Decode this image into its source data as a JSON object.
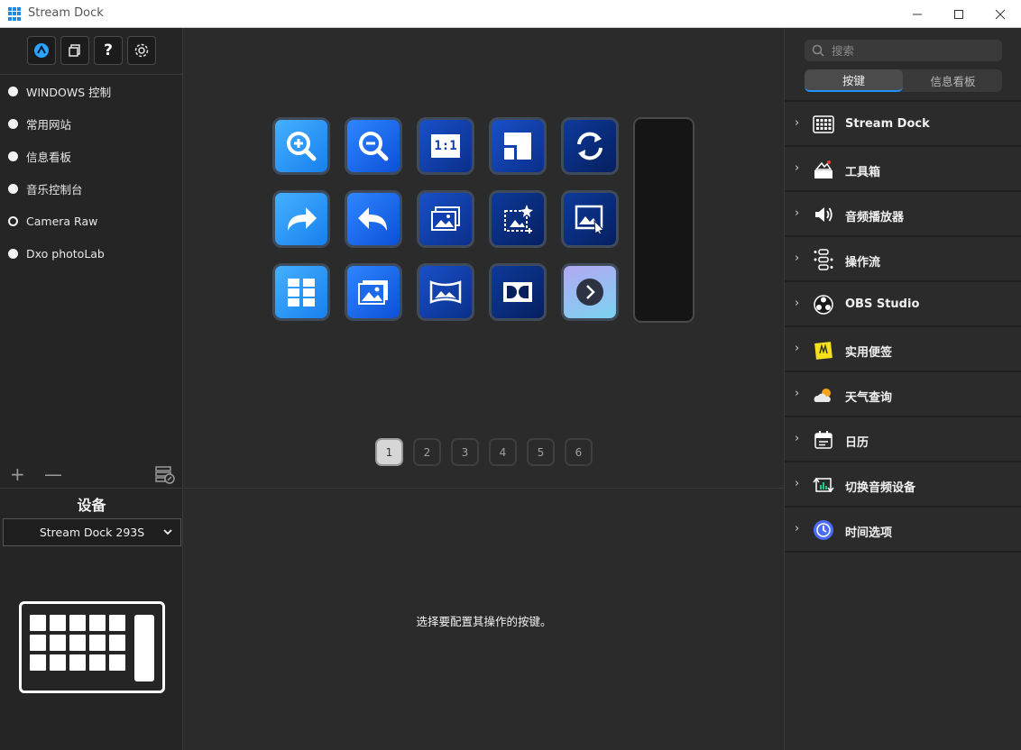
{
  "window": {
    "title": "Stream Dock"
  },
  "left_toolbar": {
    "buttons": [
      {
        "icon": "stream-dock-logo-icon"
      },
      {
        "icon": "copy-icon"
      },
      {
        "icon": "help-icon",
        "glyph": "?"
      },
      {
        "icon": "gear-icon"
      }
    ]
  },
  "profiles": [
    {
      "label": "WINDOWS 控制",
      "selected": false
    },
    {
      "label": "常用网站",
      "selected": false
    },
    {
      "label": "信息看板",
      "selected": false
    },
    {
      "label": "音乐控制台",
      "selected": false
    },
    {
      "label": "Camera Raw",
      "selected": true
    },
    {
      "label": "Dxo photoLab",
      "selected": false
    }
  ],
  "profile_actions": {
    "add": "+",
    "remove": "—"
  },
  "device": {
    "section_label": "设备",
    "selected": "Stream Dock 293S"
  },
  "keys": [
    {
      "icon": "zoom-in-icon",
      "style": "light"
    },
    {
      "icon": "zoom-out-icon",
      "style": "mid"
    },
    {
      "icon": "actual-size-icon",
      "style": "navy",
      "text": "1:1"
    },
    {
      "icon": "fit-window-icon",
      "style": "navy"
    },
    {
      "icon": "refresh-icon",
      "style": "dark"
    },
    {
      "icon": "redo-arrow-icon",
      "style": "light"
    },
    {
      "icon": "undo-arrow-icon",
      "style": "mid"
    },
    {
      "icon": "image-stack-icon",
      "style": "navy"
    },
    {
      "icon": "image-select-icon",
      "style": "dark"
    },
    {
      "icon": "image-edit-icon",
      "style": "dark"
    },
    {
      "icon": "grid-view-icon",
      "style": "light"
    },
    {
      "icon": "photo-gallery-icon",
      "style": "mid"
    },
    {
      "icon": "panorama-icon",
      "style": "navy"
    },
    {
      "icon": "dolby-icon",
      "style": "dark"
    },
    {
      "icon": "next-page-icon",
      "style": "next"
    }
  ],
  "pages": [
    "1",
    "2",
    "3",
    "4",
    "5",
    "6"
  ],
  "current_page": "1",
  "hint": "选择要配置其操作的按键。",
  "right_panel": {
    "search_placeholder": "搜索",
    "tabs": [
      {
        "label": "按键",
        "active": true
      },
      {
        "label": "信息看板",
        "active": false
      }
    ],
    "categories": [
      {
        "label": "Stream Dock",
        "icon": "keypad-icon"
      },
      {
        "label": "工具箱",
        "icon": "toolbox-icon"
      },
      {
        "label": "音频播放器",
        "icon": "speaker-icon"
      },
      {
        "label": "操作流",
        "icon": "workflow-icon"
      },
      {
        "label": "OBS Studio",
        "icon": "obs-icon"
      },
      {
        "label": "实用便签",
        "icon": "sticky-note-icon"
      },
      {
        "label": "天气查询",
        "icon": "weather-icon"
      },
      {
        "label": "日历",
        "icon": "calendar-icon"
      },
      {
        "label": "切换音频设备",
        "icon": "audio-switch-icon"
      },
      {
        "label": "时间选项",
        "icon": "clock-icon"
      }
    ]
  }
}
